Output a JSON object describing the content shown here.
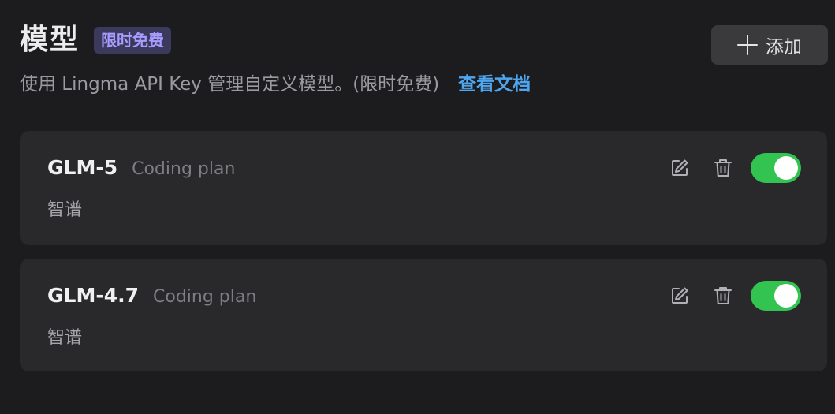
{
  "header": {
    "title": "模型",
    "badge": "限时免费",
    "subtitle": "使用 Lingma API Key 管理自定义模型。(限时免费)",
    "doc_link": "查看文档",
    "add_label": "添加"
  },
  "models": [
    {
      "name": "GLM-5",
      "plan": "Coding plan",
      "provider": "智谱",
      "enabled": true
    },
    {
      "name": "GLM-4.7",
      "plan": "Coding plan",
      "provider": "智谱",
      "enabled": true
    }
  ],
  "icons": {
    "edit": "edit-icon",
    "delete": "trash-icon",
    "add": "plus-icon"
  },
  "colors": {
    "background": "#1c1c1e",
    "card": "#29292b",
    "badge_text": "#a99cff",
    "link": "#4fa6f0",
    "toggle_on": "#32c350"
  }
}
